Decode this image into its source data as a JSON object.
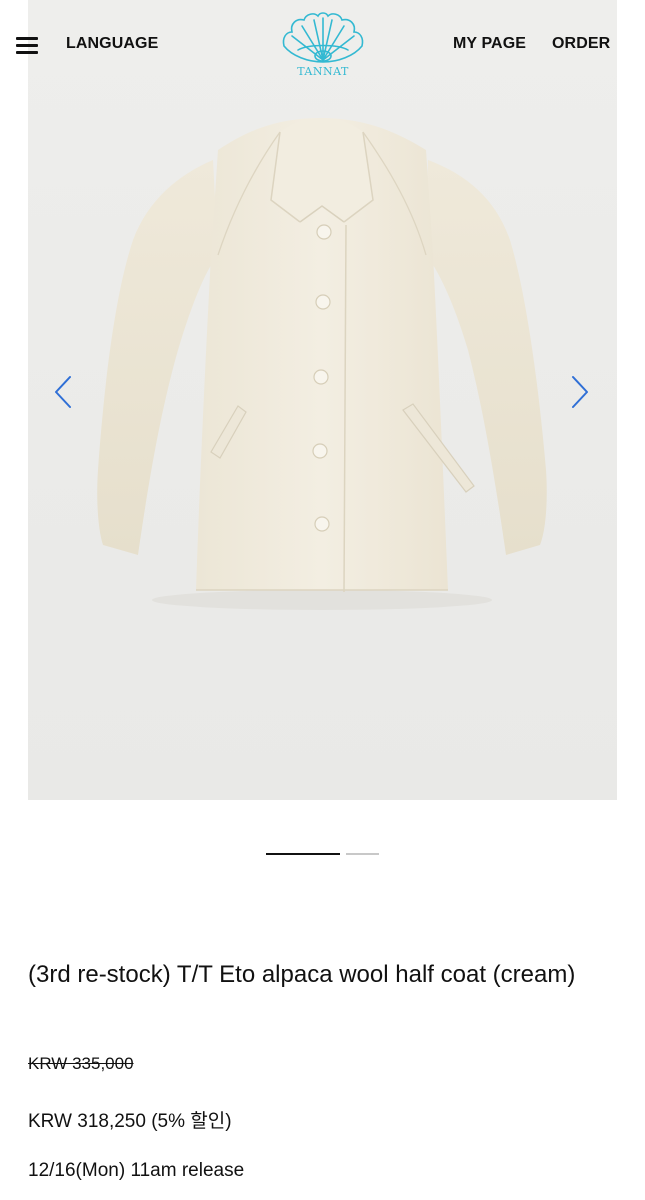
{
  "header": {
    "language_label": "LANGUAGE",
    "mypage_label": "MY PAGE",
    "order_label": "ORDER",
    "logo_text": "TANNAT",
    "brand_color": "#33b9d2"
  },
  "gallery": {
    "current_slide": 1,
    "total_slides": 2,
    "arrow_color": "#2f6fd6",
    "image_subject": "cream alpaca wool half coat"
  },
  "product": {
    "title": "(3rd re-stock) T/T Eto alpaca wool half coat (cream)",
    "original_price": "KRW 335,000",
    "sale_price": "KRW 318,250 (5% 할인)",
    "release_note": "12/16(Mon) 11am release"
  },
  "icons": [
    "hamburger-menu-icon",
    "shell-logo-icon",
    "chevron-left-icon",
    "chevron-right-icon"
  ]
}
